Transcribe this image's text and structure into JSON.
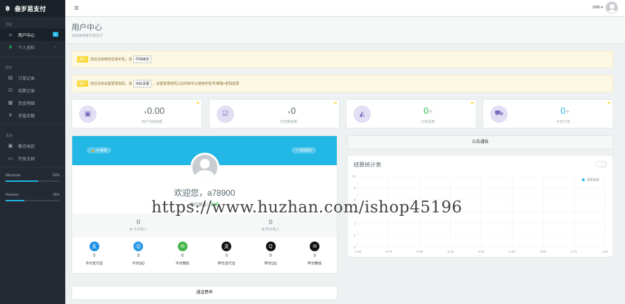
{
  "app": {
    "brand": "叁岁易支付"
  },
  "topbar": {
    "user_name": "1000 ▾"
  },
  "sidebar": {
    "sec1": "导航",
    "items_a": [
      {
        "label": "用户中心",
        "icon": "home-icon",
        "glyph": "⌂",
        "badge": "N"
      },
      {
        "label": "个人资料",
        "icon": "leaf-icon",
        "glyph": "❦"
      }
    ],
    "sec2": "服务",
    "items_b": [
      {
        "label": "订单记录",
        "icon": "list-icon",
        "glyph": "▤"
      },
      {
        "label": "结算记录",
        "icon": "check-icon",
        "glyph": "☑"
      },
      {
        "label": "资金明细",
        "icon": "calendar-icon",
        "glyph": "▦"
      },
      {
        "label": "充值余额",
        "icon": "money-icon",
        "glyph": "¥"
      }
    ],
    "sec3": "其他",
    "items_c": [
      {
        "label": "聚合收款",
        "icon": "grid-icon",
        "glyph": "▣"
      },
      {
        "label": "开发文档",
        "icon": "doc-icon",
        "glyph": "▭"
      }
    ],
    "milestone": {
      "label": "Milestone",
      "pct_text": "60%",
      "pct": 60
    },
    "release": {
      "label": "Release",
      "pct_text": "35%",
      "pct": 35
    }
  },
  "page": {
    "title": "用户中心",
    "subtitle": "欢迎使用叁岁易支付"
  },
  "alerts": [
    {
      "tag": "提示",
      "text": "您还没有绑定密保手机，请",
      "btn": "尽快绑定",
      "tail": ""
    },
    {
      "tag": "提示",
      "text": "您还没有设置登录密码，请",
      "btn": "点此设置",
      "tail": "，设置登录密码之后你就可以使用手机号/邮箱+密码登录"
    }
  ],
  "stats": [
    {
      "prefix": "¥",
      "value": "0.00",
      "unit": "",
      "label": "商户当前余额",
      "icon": "money-icon",
      "glyph": "▣",
      "color": "dark"
    },
    {
      "prefix": "¥",
      "value": "0",
      "unit": "",
      "label": "已结算余额",
      "icon": "check-icon",
      "glyph": "☑",
      "color": "dark"
    },
    {
      "prefix": "",
      "value": "0",
      "unit": "个",
      "label": "订单总数",
      "icon": "area-chart-icon",
      "glyph": "◭",
      "color": "green"
    },
    {
      "prefix": "",
      "value": "0",
      "unit": "个",
      "label": "今日订单",
      "icon": "cart-icon",
      "glyph": "⛟",
      "color": "blue"
    }
  ],
  "profile": {
    "api_btn": "🔒 API密钥",
    "edit_btn": "✎ 修改资料",
    "welcome": "欢迎您，a78900",
    "status_label": "商户状态：",
    "status_value": "正常",
    "today_income": "0",
    "today_income_label": "✚ 今日收入",
    "yesterday_income": "0",
    "yesterday_income_label": "✪ 昨日收入"
  },
  "payments": [
    {
      "label": "今日支付宝",
      "value": "0",
      "icon": "alipay-icon",
      "glyph": "支",
      "color": "#1a8fe6"
    },
    {
      "label": "今日QQ",
      "value": "0",
      "icon": "qq-icon",
      "glyph": "Q",
      "color": "#2d9be8"
    },
    {
      "label": "今日微信",
      "value": "0",
      "icon": "wechat-icon",
      "glyph": "✉",
      "color": "#44b549"
    },
    {
      "label": "昨日支付宝",
      "value": "0",
      "icon": "alipay-icon",
      "glyph": "支",
      "color": "#111111"
    },
    {
      "label": "昨日QQ",
      "value": "0",
      "icon": "qq-icon",
      "glyph": "Q",
      "color": "#111111"
    },
    {
      "label": "昨日微信",
      "value": "0",
      "icon": "wechat-icon",
      "glyph": "✉",
      "color": "#111111"
    }
  ],
  "rate_box": "通道费率",
  "notice": "公告通知",
  "chart_data": {
    "type": "line",
    "title": "结算统计表",
    "legend": "结算金额",
    "legend_position": "top-right",
    "x_ticks": [
      "-1.00",
      "-0.75",
      "-0.50",
      "-0.25",
      "0.00",
      "0.25",
      "0.50",
      "0.75",
      "1.00"
    ],
    "y_ticks": [
      "10",
      "8",
      "6",
      "4",
      "2",
      "0",
      "-2"
    ],
    "xlim": [
      -1,
      1
    ],
    "ylim": [
      -2,
      10
    ],
    "series": [
      {
        "name": "结算金额",
        "x": [],
        "y": []
      }
    ],
    "grid": true,
    "accent": "#23b7e5"
  },
  "watermark": "https://www.huzhan.com/ishop45196"
}
